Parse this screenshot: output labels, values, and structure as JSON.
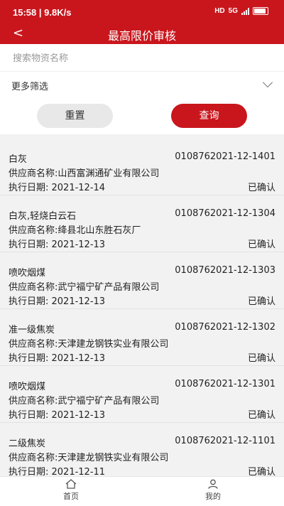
{
  "status_bar": {
    "time": "15:58",
    "speed": "9.8K/s",
    "network": "5G",
    "hd": "HD"
  },
  "header": {
    "back_glyph": "<",
    "title": "最高限价审核"
  },
  "search": {
    "placeholder": "搜索物资名称",
    "value": ""
  },
  "filter": {
    "label": "更多筛选"
  },
  "buttons": {
    "reset": "重置",
    "query": "查询"
  },
  "items": [
    {
      "name": "白灰",
      "code": "0108762021-12-1401",
      "supplier": "供应商名称:山西富渊通矿业有限公司",
      "date": "执行日期: 2021-12-14",
      "status": "已确认"
    },
    {
      "name": "白灰,轻烧白云石",
      "code": "0108762021-12-1304",
      "supplier": "供应商名称:绛县北山东胜石灰厂",
      "date": "执行日期: 2021-12-13",
      "status": "已确认"
    },
    {
      "name": "喷吹烟煤",
      "code": "0108762021-12-1303",
      "supplier": "供应商名称:武宁福宁矿产品有限公司",
      "date": "执行日期: 2021-12-13",
      "status": "已确认"
    },
    {
      "name": "准一级焦炭",
      "code": "0108762021-12-1302",
      "supplier": "供应商名称:天津建龙钢铁实业有限公司",
      "date": "执行日期: 2021-12-13",
      "status": "已确认"
    },
    {
      "name": "喷吹烟煤",
      "code": "0108762021-12-1301",
      "supplier": "供应商名称:武宁福宁矿产品有限公司",
      "date": "执行日期: 2021-12-13",
      "status": "已确认"
    },
    {
      "name": "二级焦炭",
      "code": "0108762021-12-1101",
      "supplier": "供应商名称:天津建龙钢铁实业有限公司",
      "date": "执行日期: 2021-12-11",
      "status": "已确认"
    }
  ],
  "tabs": {
    "home": "首页",
    "mine": "我的"
  },
  "icons": {
    "back": "back-arrow-icon",
    "chevron": "chevron-down-icon",
    "home": "home-icon",
    "user": "user-icon"
  },
  "colors": {
    "brand": "#c9161d",
    "background": "#f2f2f2"
  }
}
